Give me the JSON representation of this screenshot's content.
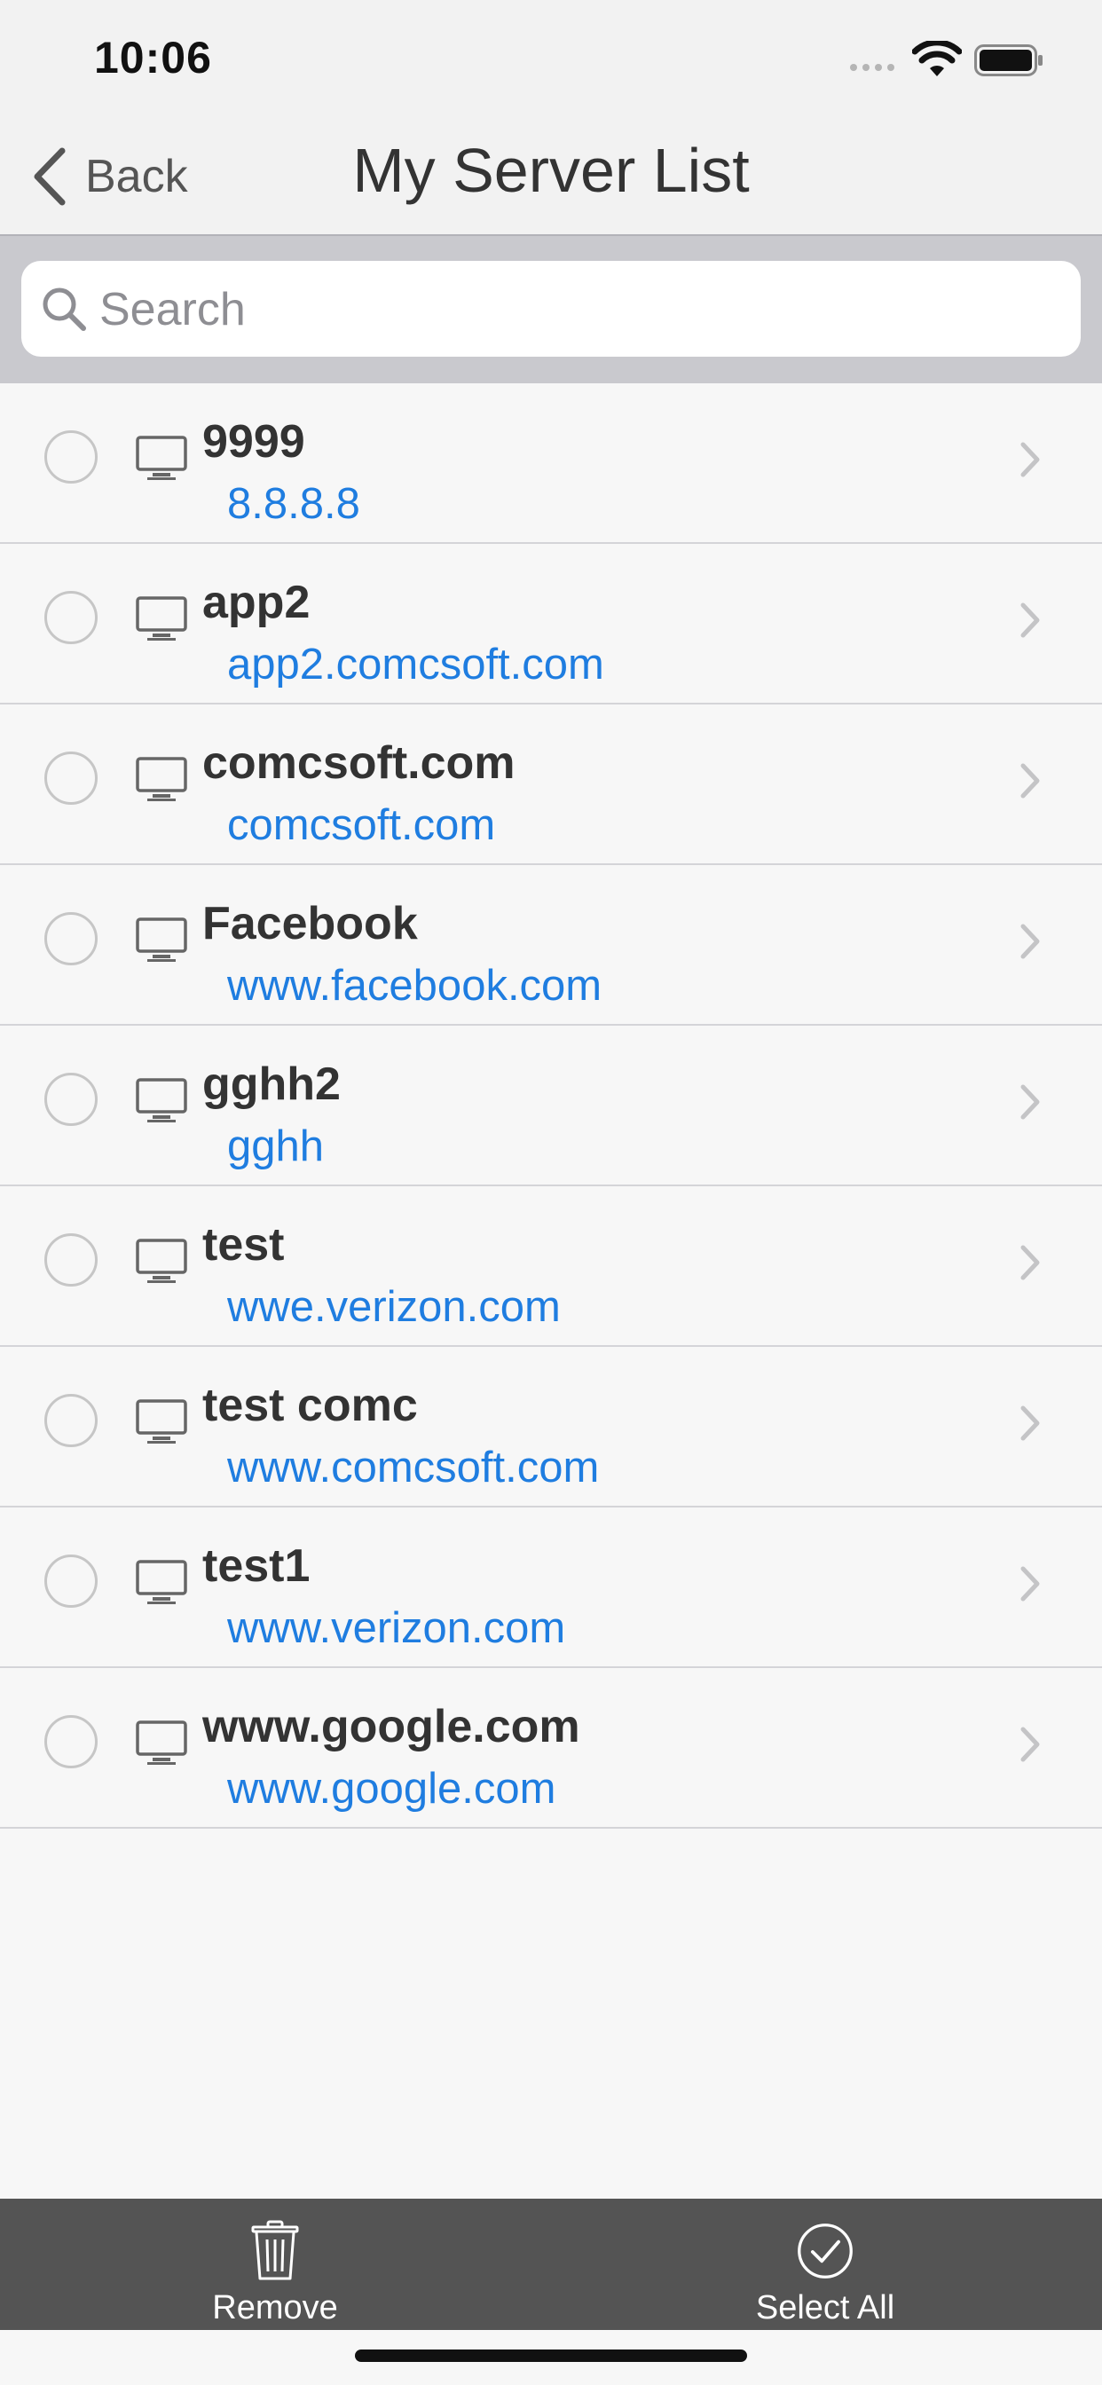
{
  "status_bar": {
    "time": "10:06"
  },
  "nav": {
    "back_label": "Back",
    "title": "My Server List"
  },
  "search": {
    "placeholder": "Search",
    "value": ""
  },
  "servers": [
    {
      "name": "9999",
      "host": "8.8.8.8"
    },
    {
      "name": "app2",
      "host": "app2.comcsoft.com"
    },
    {
      "name": "comcsoft.com",
      "host": "comcsoft.com"
    },
    {
      "name": "Facebook",
      "host": "www.facebook.com"
    },
    {
      "name": "gghh2",
      "host": "gghh"
    },
    {
      "name": "test",
      "host": "wwe.verizon.com"
    },
    {
      "name": "test comc",
      "host": "www.comcsoft.com"
    },
    {
      "name": "test1",
      "host": "www.verizon.com"
    },
    {
      "name": "www.google.com",
      "host": "www.google.com"
    }
  ],
  "toolbar": {
    "remove_label": "Remove",
    "select_all_label": "Select All"
  },
  "colors": {
    "link": "#1f7de0",
    "toolbar": "#545454",
    "search_bg": "#c9c9ce"
  },
  "icons": {
    "back": "chevron-left-icon",
    "search": "magnifier-icon",
    "server": "monitor-icon",
    "row": "chevron-right-icon",
    "remove": "trash-icon",
    "select_all": "check-circle-icon"
  }
}
